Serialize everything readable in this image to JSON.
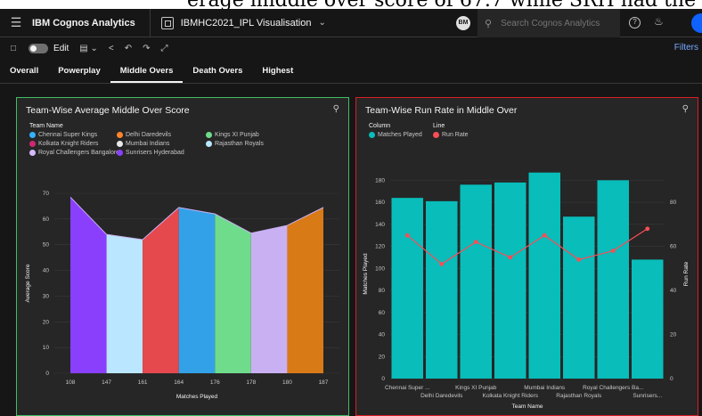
{
  "caption": "erage middle over score of 67.7 while SRH had the highest run rate in midd",
  "appbar": {
    "brand": "IBM Cognos Analytics",
    "report_title": "IBMHC2021_IPL Visualisation",
    "user_initials": "BM",
    "search_placeholder": "Search Cognos Analytics"
  },
  "toolbar": {
    "edit_label": "Edit",
    "filters_label": "Filters"
  },
  "tabs": [
    "Overall",
    "Powerplay",
    "Middle Overs",
    "Death Overs",
    "Highest"
  ],
  "active_tab": "Middle Overs",
  "left_panel": {
    "title": "Team-Wise Average Middle Over  Score",
    "legend_title": "Team Name",
    "legend": [
      {
        "label": "Chennai Super Kings",
        "color": "#33b1ff"
      },
      {
        "label": "Delhi Daredevils",
        "color": "#ff832b"
      },
      {
        "label": "Kings XI Punjab",
        "color": "#6fdc8c"
      },
      {
        "label": "Kolkata Knight Riders",
        "color": "#d12771"
      },
      {
        "label": "Mumbai Indians",
        "color": "#e8e8e8"
      },
      {
        "label": "Rajasthan Royals",
        "color": "#bae6ff"
      },
      {
        "label": "Royal Challengers Bangalore",
        "color": "#d4bbff"
      },
      {
        "label": "Sunrisers Hyderabad",
        "color": "#8a3ffc"
      }
    ]
  },
  "right_panel": {
    "title": "Team-Wise Run Rate in Middle Over",
    "legend_column_title": "Column",
    "legend_line_title": "Line",
    "legend_column": {
      "label": "Matches Played",
      "color": "#08bdba"
    },
    "legend_line": {
      "label": "Run Rate",
      "color": "#fa4d56"
    }
  },
  "chart_data": [
    {
      "type": "area",
      "title": "Team-Wise Average Middle Over  Score",
      "xlabel": "Matches Played",
      "ylabel": "Average Score",
      "x": [
        "108",
        "147",
        "161",
        "164",
        "176",
        "178",
        "180",
        "187"
      ],
      "ylim": [
        0,
        70
      ],
      "yticks": [
        0,
        10,
        20,
        30,
        40,
        50,
        60,
        70
      ],
      "series": [
        {
          "name": "Sunrisers Hyderabad",
          "color": "#8a3ffc",
          "points": [
            [
              0,
              68.5
            ],
            [
              1,
              54
            ]
          ]
        },
        {
          "name": "Rajasthan Royals",
          "color": "#bae6ff",
          "points": [
            [
              1,
              54
            ],
            [
              2,
              52
            ]
          ]
        },
        {
          "name": "Delhi Daredevils",
          "color": "#e5484d",
          "points": [
            [
              2,
              52
            ],
            [
              3,
              64.5
            ]
          ]
        },
        {
          "name": "Chennai Super Kings",
          "color": "#33a1e8",
          "points": [
            [
              3,
              64.5
            ],
            [
              4,
              62
            ]
          ]
        },
        {
          "name": "Kings XI Punjab",
          "color": "#6fdc8c",
          "points": [
            [
              4,
              62
            ],
            [
              5,
              54.5
            ]
          ]
        },
        {
          "name": "Kolkata Knight Riders",
          "color": "#c7276b",
          "points": [
            [
              5,
              54.5
            ],
            [
              6,
              57.5
            ]
          ]
        },
        {
          "name": "Royal Challengers Bangalore",
          "color": "#c9b0f2",
          "points": [
            [
              5,
              54.5
            ],
            [
              6,
              57.5
            ]
          ]
        },
        {
          "name": "Mumbai Indians",
          "color": "#d87a16",
          "points": [
            [
              6,
              57.5
            ],
            [
              7,
              64.5
            ]
          ]
        }
      ],
      "line": {
        "color": "#c9b0f2",
        "x": [
          0,
          1,
          2,
          3,
          4,
          5,
          6,
          7
        ],
        "y": [
          68.5,
          54,
          52,
          64.5,
          62,
          54.5,
          57.5,
          64.5
        ]
      }
    },
    {
      "type": "bar",
      "title": "Team-Wise Run Rate in Middle Over",
      "xlabel": "Team Name",
      "ylabel": "Matches Played",
      "y2label": "Run Rate",
      "categories": [
        "Chennai Super ...",
        "Delhi Daredevils",
        "Kings XI Punjab",
        "Kolkata Knight Riders",
        "Mumbai Indians",
        "Rajasthan Royals",
        "Royal Challengers Ba...",
        "Sunrisers..."
      ],
      "ylim": [
        0,
        190
      ],
      "yticks": [
        0,
        20,
        40,
        60,
        80,
        100,
        120,
        140,
        160,
        180
      ],
      "y2lim": [
        0,
        95
      ],
      "y2ticks": [
        0,
        20,
        40,
        60,
        80
      ],
      "series": [
        {
          "name": "Matches Played",
          "color": "#08bdba",
          "values": [
            164,
            161,
            176,
            178,
            187,
            147,
            180,
            108
          ]
        },
        {
          "name": "Run Rate",
          "color": "#fa4d56",
          "axis": "right",
          "values": [
            65,
            52,
            62,
            55,
            65,
            54,
            58,
            68
          ]
        }
      ]
    }
  ]
}
